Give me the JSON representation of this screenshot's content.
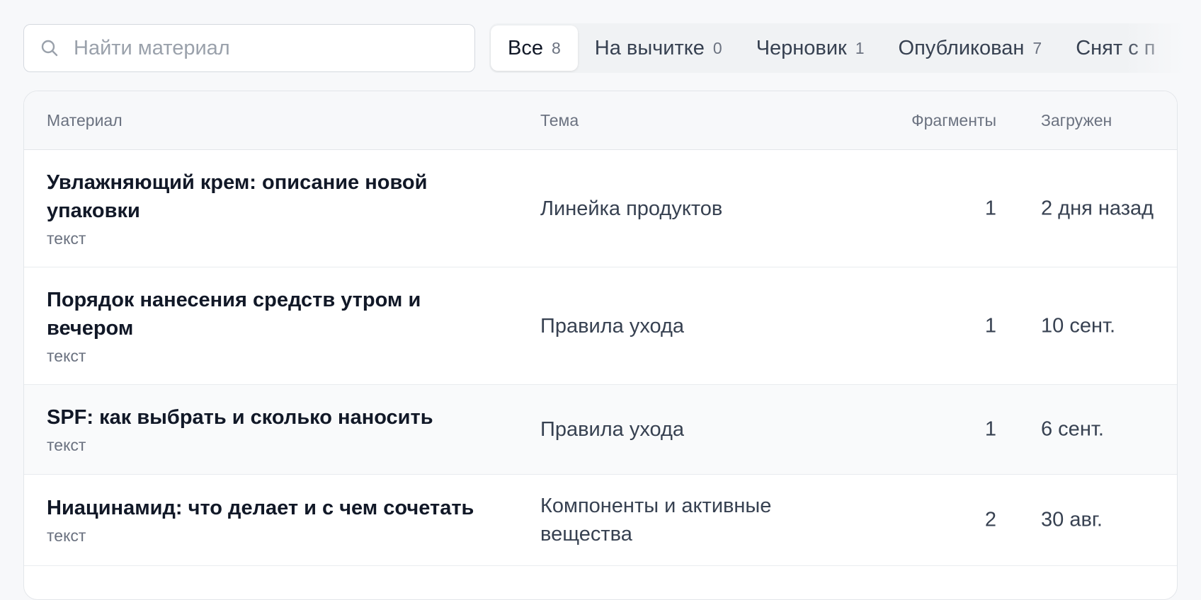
{
  "search": {
    "placeholder": "Найти материал",
    "value": ""
  },
  "tabs": [
    {
      "label": "Все",
      "count": "8",
      "active": true
    },
    {
      "label": "На вычитке",
      "count": "0",
      "active": false
    },
    {
      "label": "Черновик",
      "count": "1",
      "active": false
    },
    {
      "label": "Опубликован",
      "count": "7",
      "active": false
    },
    {
      "label": "Снят с п",
      "count": "",
      "active": false
    }
  ],
  "table": {
    "headers": {
      "material": "Материал",
      "topic": "Тема",
      "fragments": "Фрагменты",
      "uploaded": "Загружен"
    },
    "rows": [
      {
        "title": "Увлажняющий крем: описание новой упаковки",
        "type": "текст",
        "topic": "Линейка продуктов",
        "fragments": "1",
        "uploaded": "2 дня назад"
      },
      {
        "title": "Порядок нанесения средств утром и вечером",
        "type": "текст",
        "topic": "Правила ухода",
        "fragments": "1",
        "uploaded": "10 сент."
      },
      {
        "title": "SPF: как выбрать и сколько наносить",
        "type": "текст",
        "topic": "Правила ухода",
        "fragments": "1",
        "uploaded": "6 сент."
      },
      {
        "title": "Ниацинамид: что делает и с чем сочетать",
        "type": "текст",
        "topic": "Компоненты и активные вещества",
        "fragments": "2",
        "uploaded": "30 авг."
      }
    ]
  },
  "icons": {
    "search": "search-icon"
  },
  "colors": {
    "page_bg": "#f7f8fa",
    "text_primary": "#111827",
    "text_secondary": "#6b7280",
    "border": "#e3e6ea"
  }
}
